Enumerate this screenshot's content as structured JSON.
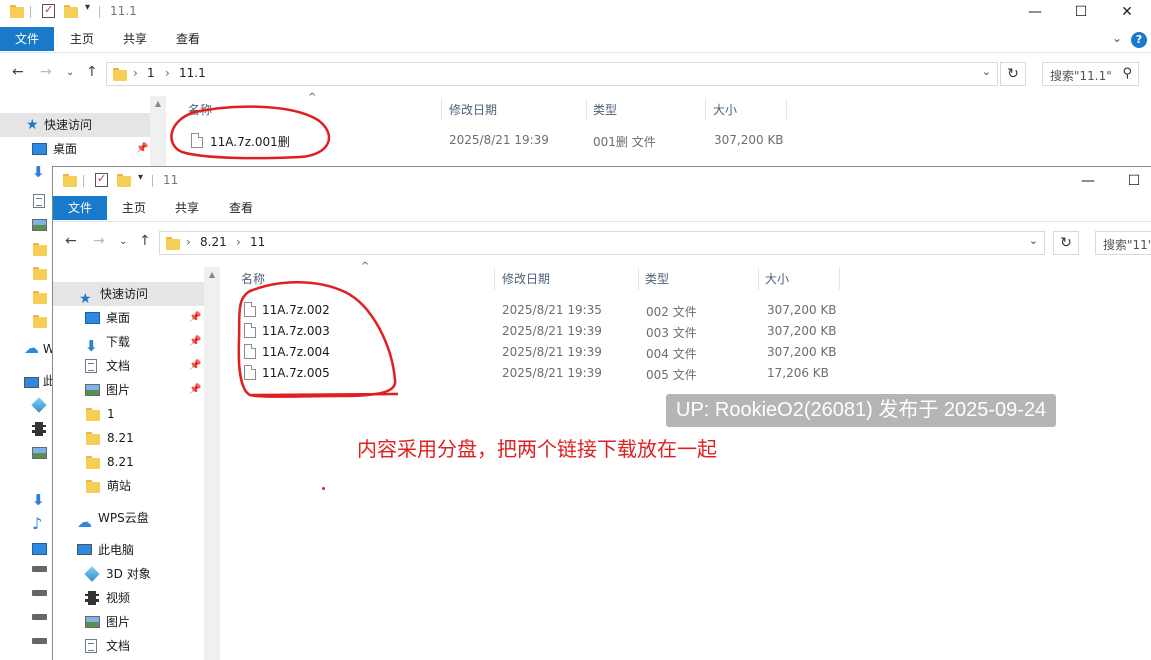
{
  "back_window": {
    "title": "11.1",
    "ribbon_tabs": [
      "文件",
      "主页",
      "共享",
      "查看"
    ],
    "address": [
      "1",
      "11.1"
    ],
    "search_placeholder": "搜索\"11.1\"",
    "nav": {
      "quick_access": "快速访问",
      "desktop": "桌面",
      "wps_partial": "W",
      "pc_partial": "此"
    },
    "columns": [
      "名称",
      "修改日期",
      "类型",
      "大小"
    ],
    "files": [
      {
        "name": "11A.7z.001删",
        "modified": "2025/8/21 19:39",
        "type": "001删 文件",
        "size": "307,200 KB"
      }
    ]
  },
  "front_window": {
    "title": "11",
    "ribbon_tabs": [
      "文件",
      "主页",
      "共享",
      "查看"
    ],
    "address": [
      "8.21",
      "11"
    ],
    "search_placeholder": "搜索\"11\"",
    "nav": [
      {
        "label": "快速访问",
        "icon": "star-icon",
        "pinned": false
      },
      {
        "label": "桌面",
        "icon": "desktop-icon",
        "pinned": true
      },
      {
        "label": "下载",
        "icon": "download-icon",
        "pinned": true
      },
      {
        "label": "文档",
        "icon": "document-icon",
        "pinned": true
      },
      {
        "label": "图片",
        "icon": "picture-icon",
        "pinned": true
      },
      {
        "label": "1",
        "icon": "folder-icon",
        "pinned": false
      },
      {
        "label": "8.21",
        "icon": "folder-icon",
        "pinned": false
      },
      {
        "label": "8.21",
        "icon": "folder-icon",
        "pinned": false
      },
      {
        "label": "萌站",
        "icon": "folder-icon",
        "pinned": false
      },
      {
        "label": "WPS云盘",
        "icon": "cloud-icon",
        "pinned": false
      },
      {
        "label": "此电脑",
        "icon": "computer-icon",
        "pinned": false
      },
      {
        "label": "3D 对象",
        "icon": "3d-objects-icon",
        "pinned": false
      },
      {
        "label": "视频",
        "icon": "video-icon",
        "pinned": false
      },
      {
        "label": "图片",
        "icon": "picture-icon",
        "pinned": false
      },
      {
        "label": "文档",
        "icon": "document-icon",
        "pinned": false
      }
    ],
    "columns": [
      "名称",
      "修改日期",
      "类型",
      "大小"
    ],
    "files": [
      {
        "name": "11A.7z.002",
        "modified": "2025/8/21 19:35",
        "type": "002 文件",
        "size": "307,200 KB"
      },
      {
        "name": "11A.7z.003",
        "modified": "2025/8/21 19:39",
        "type": "003 文件",
        "size": "307,200 KB"
      },
      {
        "name": "11A.7z.004",
        "modified": "2025/8/21 19:39",
        "type": "004 文件",
        "size": "307,200 KB"
      },
      {
        "name": "11A.7z.005",
        "modified": "2025/8/21 19:39",
        "type": "005 文件",
        "size": "17,206 KB"
      }
    ]
  },
  "overlay": {
    "watermark": "UP: RookieO2(26081) 发布于 2025-09-24",
    "annotation": "内容采用分盘，把两个链接下载放在一起",
    "annotation_color": "#e02020"
  },
  "colors": {
    "accent": "#1979ca"
  }
}
